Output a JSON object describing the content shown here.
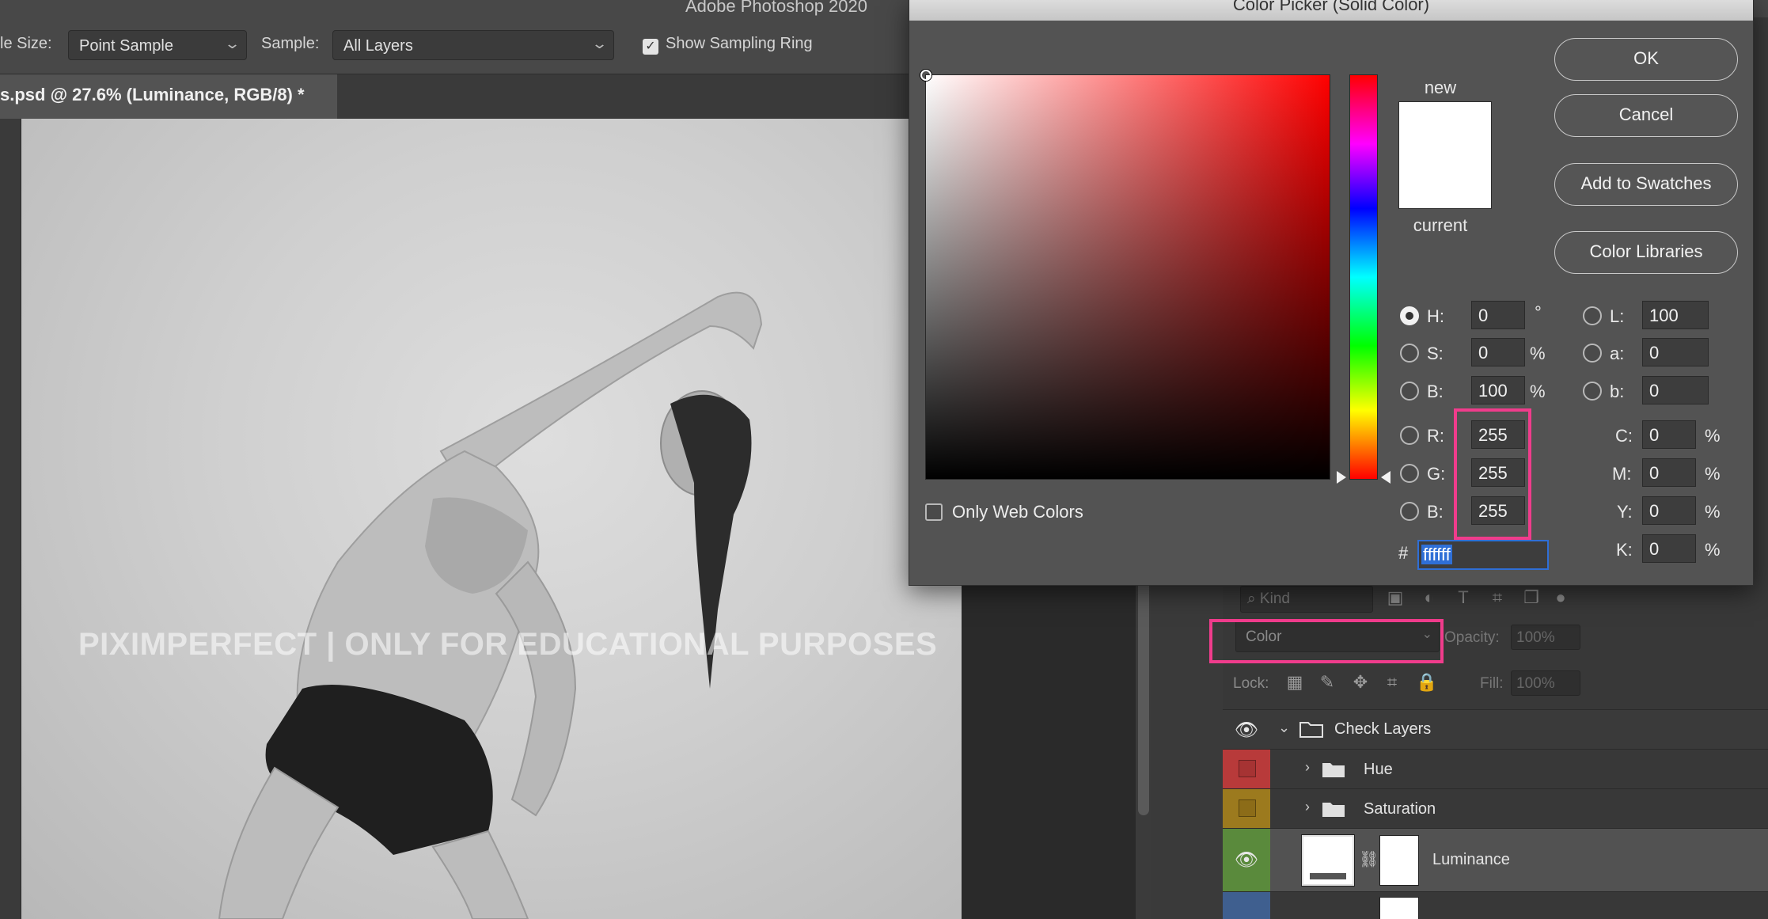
{
  "app": {
    "title": "Adobe Photoshop 2020"
  },
  "options_bar": {
    "sample_size_label": "le Size:",
    "sample_size_value": "Point Sample",
    "sample_label": "Sample:",
    "sample_value": "All Layers",
    "show_ring_label": "Show Sampling Ring",
    "show_ring_checked": true
  },
  "document": {
    "tab_title": "s.psd @ 27.6% (Luminance, RGB/8) *",
    "watermark": "PIXIMPERFECT | ONLY FOR EDUCATIONAL PURPOSES"
  },
  "color_picker": {
    "title": "Color Picker (Solid Color)",
    "new_label": "new",
    "current_label": "current",
    "new_color": "#ffffff",
    "current_color": "#ffffff",
    "buttons": {
      "ok": "OK",
      "cancel": "Cancel",
      "add_swatches": "Add to Swatches",
      "color_libraries": "Color Libraries"
    },
    "only_web_colors": "Only Web Colors",
    "fields": {
      "h": {
        "label": "H:",
        "value": "0",
        "unit": "°"
      },
      "s": {
        "label": "S:",
        "value": "0",
        "unit": "%"
      },
      "b": {
        "label": "B:",
        "value": "100",
        "unit": "%"
      },
      "r": {
        "label": "R:",
        "value": "255"
      },
      "g": {
        "label": "G:",
        "value": "255"
      },
      "b2": {
        "label": "B:",
        "value": "255"
      },
      "l": {
        "label": "L:",
        "value": "100"
      },
      "a": {
        "label": "a:",
        "value": "0"
      },
      "lab_b": {
        "label": "b:",
        "value": "0"
      },
      "c": {
        "label": "C:",
        "value": "0",
        "unit": "%"
      },
      "m": {
        "label": "M:",
        "value": "0",
        "unit": "%"
      },
      "y": {
        "label": "Y:",
        "value": "0",
        "unit": "%"
      },
      "k": {
        "label": "K:",
        "value": "0",
        "unit": "%"
      }
    },
    "hex_label": "#",
    "hex_value": "ffffff",
    "highlight_color": "#f03c8c"
  },
  "layers_panel": {
    "kind_placeholder": "Kind",
    "blend_mode": "Color",
    "opacity_label": "Opacity:",
    "opacity_value": "100%",
    "lock_label": "Lock:",
    "fill_label": "Fill:",
    "fill_value": "100%",
    "layers": [
      {
        "name": "Check Layers",
        "type": "group",
        "expanded": true,
        "visible": true,
        "tag_color": ""
      },
      {
        "name": "Hue",
        "type": "group",
        "expanded": false,
        "visible": false,
        "tag_color": "#b83a3a"
      },
      {
        "name": "Saturation",
        "type": "group",
        "expanded": false,
        "visible": false,
        "tag_color": "#9c7a1e"
      },
      {
        "name": "Luminance",
        "type": "adjustment",
        "visible": true,
        "selected": true,
        "tag_color": "#5a8a3c"
      },
      {
        "name": "",
        "type": "adjustment",
        "visible": false,
        "tag_color": "#3f5f8f"
      }
    ]
  }
}
